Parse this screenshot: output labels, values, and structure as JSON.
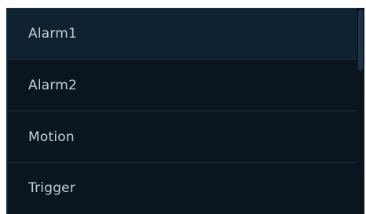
{
  "list": {
    "items": [
      {
        "label": "Alarm1",
        "selected": true
      },
      {
        "label": "Alarm2",
        "selected": false
      },
      {
        "label": "Motion",
        "selected": false
      },
      {
        "label": "Trigger",
        "selected": false
      }
    ]
  },
  "colors": {
    "panel_background": "#0a151e",
    "selected_background": "#0f2231",
    "separator": "#1c2f3d",
    "text": "#c6ced5"
  }
}
